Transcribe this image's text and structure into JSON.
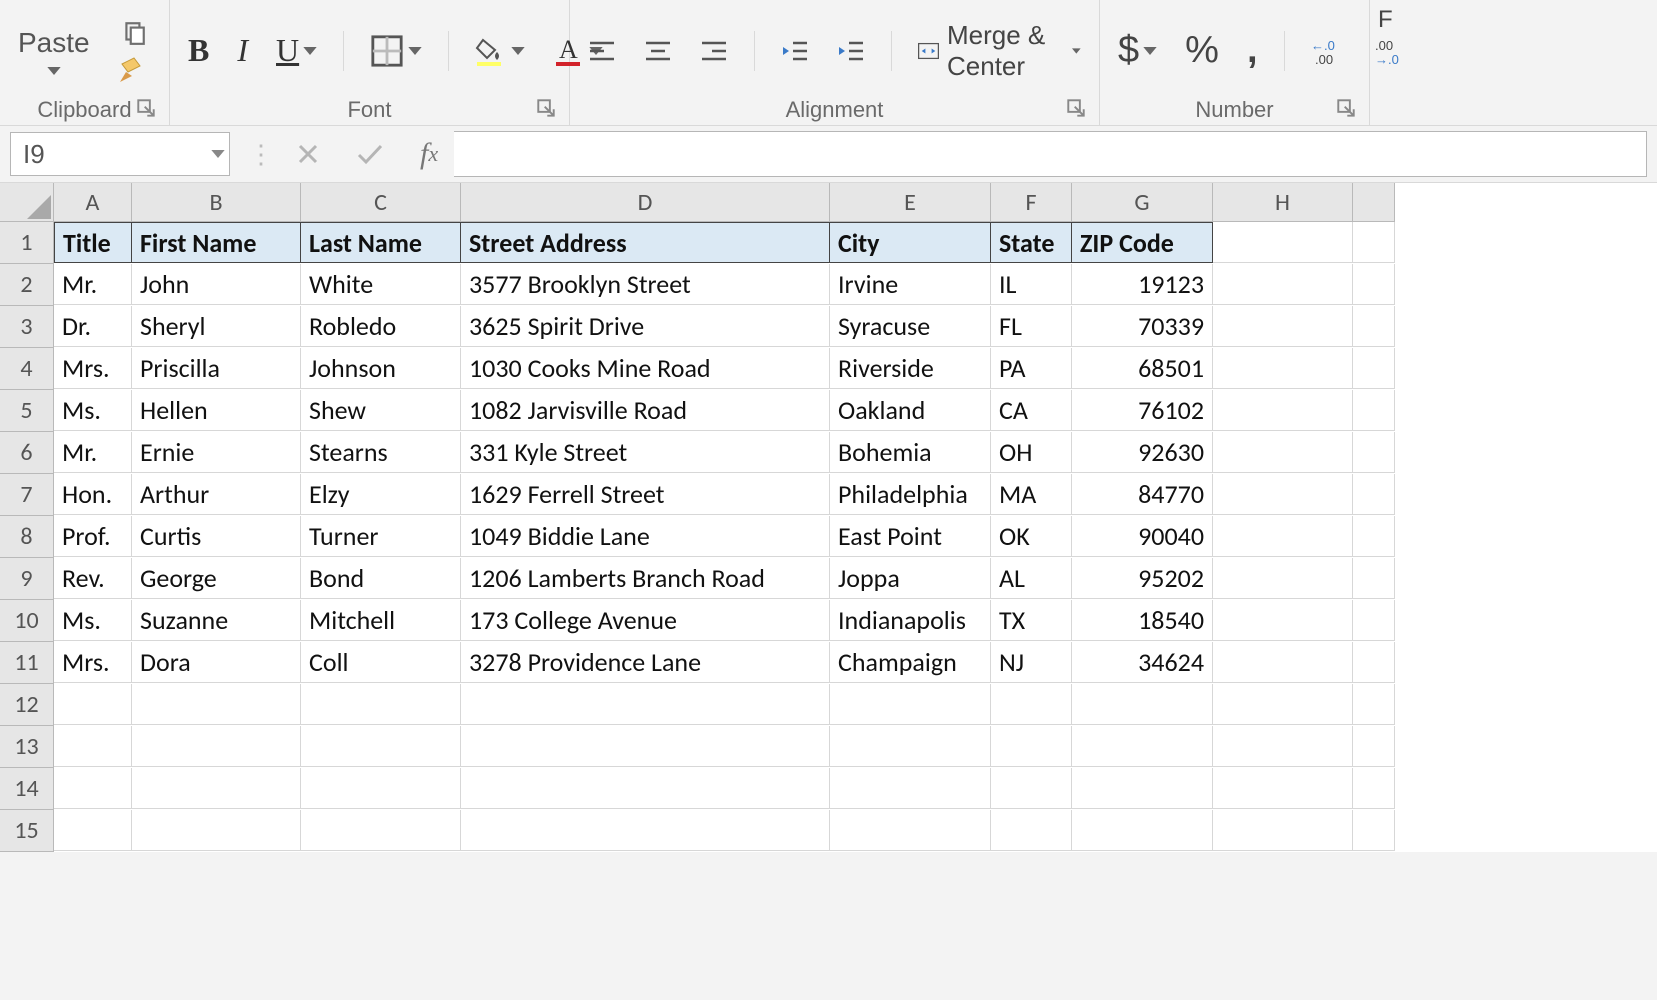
{
  "ribbon": {
    "clipboard": {
      "paste": "Paste",
      "label": "Clipboard"
    },
    "font": {
      "bold": "B",
      "italic": "I",
      "underline": "U",
      "label": "Font"
    },
    "alignment": {
      "merge_center": "Merge & Center",
      "label": "Alignment"
    },
    "number": {
      "currency": "$",
      "percent": "%",
      "comma": ",",
      "label": "Number"
    },
    "format_partial": "F"
  },
  "formula_bar": {
    "name_box": "I9",
    "fx_label": "fx"
  },
  "columns": [
    "A",
    "B",
    "C",
    "D",
    "E",
    "F",
    "G",
    "H"
  ],
  "row_numbers": [
    1,
    2,
    3,
    4,
    5,
    6,
    7,
    8,
    9,
    10,
    11,
    12,
    13,
    14,
    15
  ],
  "table": {
    "headers": [
      "Title",
      "First Name",
      "Last Name",
      "Street Address",
      "City",
      "State",
      "ZIP Code"
    ],
    "rows": [
      [
        "Mr.",
        "John",
        "White",
        "3577 Brooklyn Street",
        "Irvine",
        "IL",
        "19123"
      ],
      [
        "Dr.",
        "Sheryl",
        "Robledo",
        "3625 Spirit Drive",
        "Syracuse",
        "FL",
        "70339"
      ],
      [
        "Mrs.",
        "Priscilla",
        "Johnson",
        "1030 Cooks Mine Road",
        "Riverside",
        "PA",
        "68501"
      ],
      [
        "Ms.",
        "Hellen",
        "Shew",
        "1082 Jarvisville Road",
        "Oakland",
        "CA",
        "76102"
      ],
      [
        "Mr.",
        "Ernie",
        "Stearns",
        "331 Kyle Street",
        "Bohemia",
        "OH",
        "92630"
      ],
      [
        "Hon.",
        "Arthur",
        "Elzy",
        "1629 Ferrell Street",
        "Philadelphia",
        "MA",
        "84770"
      ],
      [
        "Prof.",
        "Curtis",
        "Turner",
        "1049 Biddie Lane",
        "East Point",
        "OK",
        "90040"
      ],
      [
        "Rev.",
        "George",
        "Bond",
        "1206 Lamberts Branch Road",
        "Joppa",
        "AL",
        "95202"
      ],
      [
        "Ms.",
        "Suzanne",
        "Mitchell",
        "173 College Avenue",
        "Indianapolis",
        "TX",
        "18540"
      ],
      [
        "Mrs.",
        "Dora",
        "Coll",
        "3278 Providence Lane",
        "Champaign",
        "NJ",
        "34624"
      ]
    ]
  }
}
